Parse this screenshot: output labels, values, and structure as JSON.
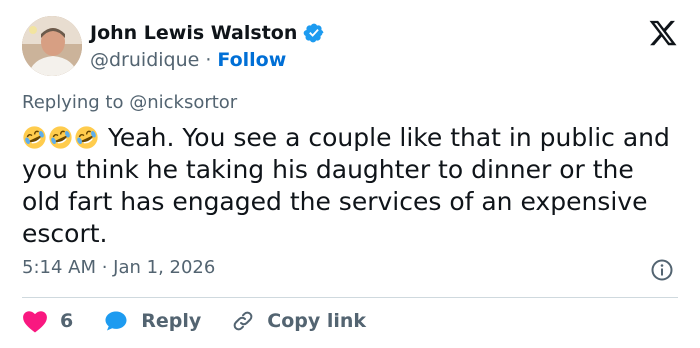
{
  "author": {
    "name": "John Lewis Walston",
    "handle": "@druidique",
    "separator": "·",
    "follow_label": "Follow",
    "verified_color": "#1d9bf0"
  },
  "platform_icon": "x-logo-icon",
  "reply_context": {
    "prefix": "Replying to",
    "mention": "@nicksortor"
  },
  "tweet": {
    "emojis": [
      "rolling-on-floor-laughing-emoji",
      "rolling-on-floor-laughing-emoji",
      "rolling-on-floor-laughing-emoji"
    ],
    "text": "Yeah. You see a couple like that in public and you think he taking his daughter to dinner or the old fart has engaged the services of an expensive escort.",
    "timestamp": "5:14 AM · Jan 1, 2026"
  },
  "actions": {
    "like_count": "6",
    "reply_label": "Reply",
    "copy_link_label": "Copy link"
  },
  "colors": {
    "text_primary": "#0f1419",
    "text_secondary": "#536471",
    "link": "#006fd6",
    "like": "#f91880",
    "reply": "#1d9bf0",
    "divider": "#cfd9de"
  }
}
